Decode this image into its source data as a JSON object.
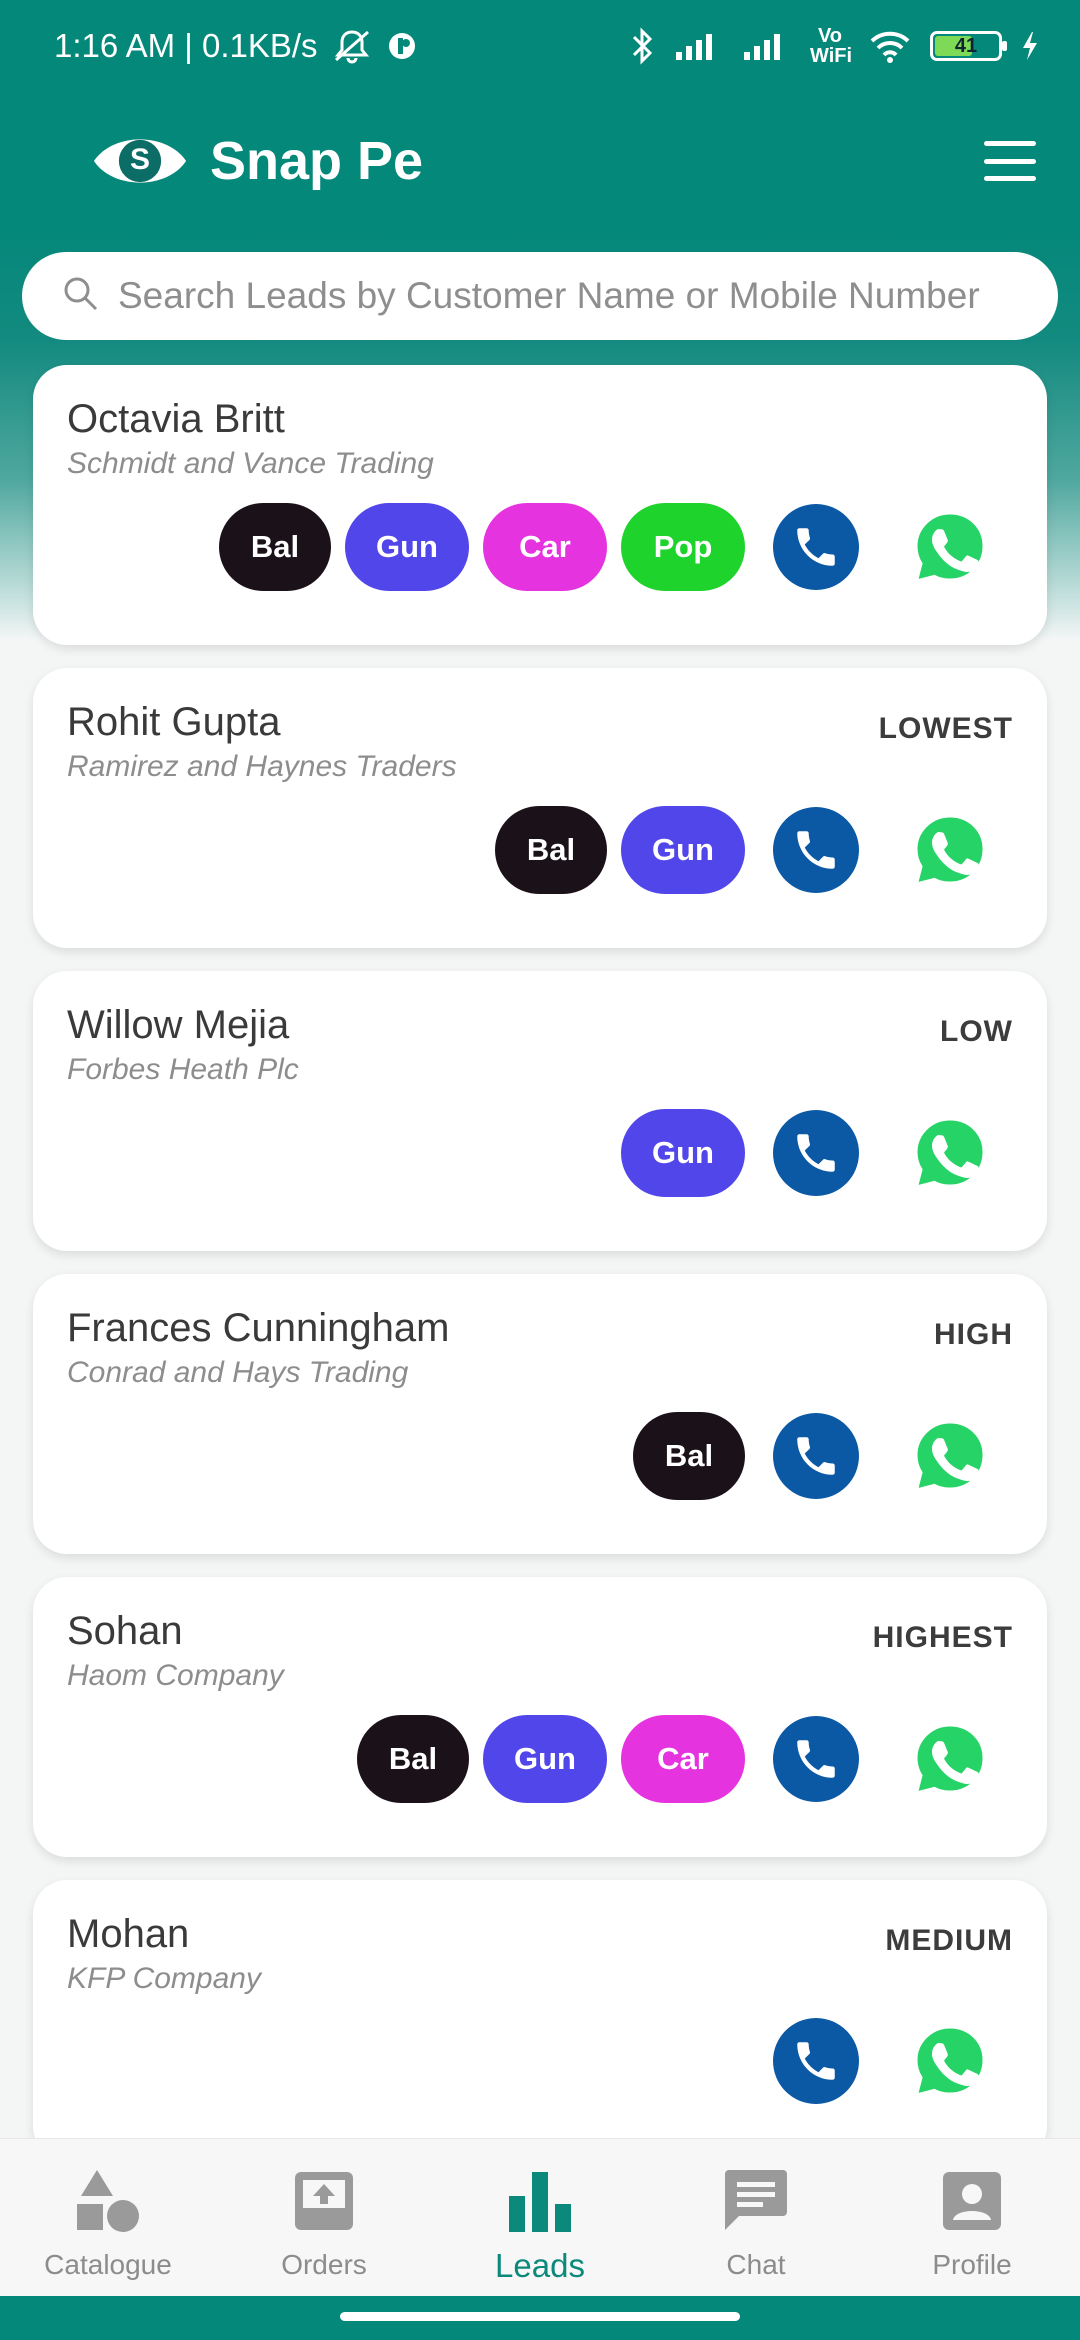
{
  "status_bar": {
    "time_speed": "1:16 AM | 0.1KB/s",
    "network_label": "Vo WiFi",
    "battery_level": "41"
  },
  "header": {
    "logo_letter": "S",
    "app_title": "Snap Pe"
  },
  "search": {
    "placeholder": "Search Leads by Customer Name or Mobile Number"
  },
  "leads": [
    {
      "name": "Octavia Britt",
      "company": "Schmidt and Vance Trading",
      "priority": "",
      "tags": [
        "Bal",
        "Gun",
        "Car",
        "Pop"
      ]
    },
    {
      "name": "Rohit Gupta",
      "company": "Ramirez and Haynes Traders",
      "priority": "LOWEST",
      "tags": [
        "Bal",
        "Gun"
      ]
    },
    {
      "name": "Willow Mejia",
      "company": "Forbes Heath Plc",
      "priority": "LOW",
      "tags": [
        "Gun"
      ]
    },
    {
      "name": "Frances Cunningham",
      "company": "Conrad and Hays Trading",
      "priority": "HIGH",
      "tags": [
        "Bal"
      ]
    },
    {
      "name": "Sohan",
      "company": "Haom Company",
      "priority": "HIGHEST",
      "tags": [
        "Bal",
        "Gun",
        "Car"
      ]
    },
    {
      "name": "Mohan",
      "company": "KFP Company",
      "priority": "MEDIUM",
      "tags": []
    }
  ],
  "tag_colors": {
    "Bal": "#1b1119",
    "Gun": "#5146ea",
    "Car": "#e633e0",
    "Pop": "#1ed42c"
  },
  "colors": {
    "brand_teal": "#04887a",
    "call_blue": "#0b58a4",
    "whatsapp_green": "#25d366"
  },
  "bottom_nav": {
    "catalogue": "Catalogue",
    "orders": "Orders",
    "leads": "Leads",
    "chat": "Chat",
    "profile": "Profile",
    "active": "Leads"
  }
}
